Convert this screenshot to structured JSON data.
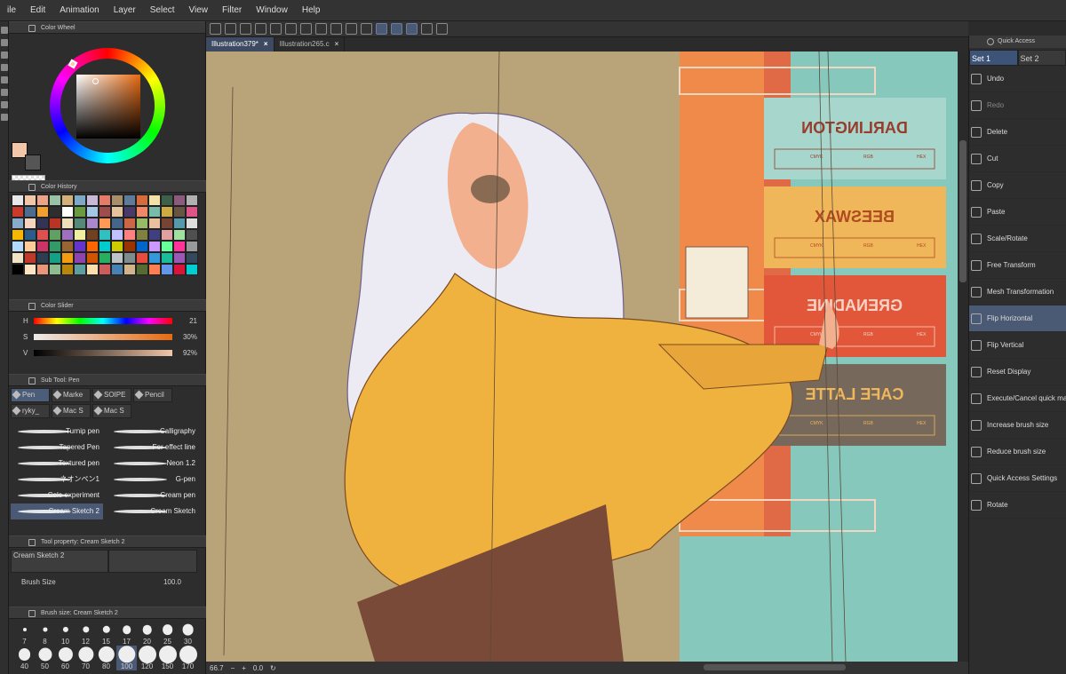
{
  "menu": [
    "ile",
    "Edit",
    "Animation",
    "Layer",
    "Select",
    "View",
    "Filter",
    "Window",
    "Help"
  ],
  "panels": {
    "color_wheel": "Color Wheel",
    "color_history": "Color History",
    "color_slider": "Color Slider",
    "sub_tool": "Sub Tool: Pen",
    "tool_property": "Tool property: Cream Sketch 2",
    "brush_size_panel": "Brush size: Cream Sketch 2"
  },
  "hsv_readout": {
    "h": "21",
    "s": "30",
    "v": "92"
  },
  "sliders": [
    {
      "label": "H",
      "value": "21",
      "gradient": "linear-gradient(to right,#f00,#ff0,#0f0,#0ff,#00f,#f0f,#f00)"
    },
    {
      "label": "S",
      "value": "30%",
      "gradient": "linear-gradient(to right,#ebebeb,#e86a12)"
    },
    {
      "label": "V",
      "value": "92%",
      "gradient": "linear-gradient(to right,#000,#f1c6a9)"
    }
  ],
  "history_colors": [
    "#e8e8e8",
    "#f1c6a9",
    "#e9a48a",
    "#9ac3a5",
    "#d4b07a",
    "#7da9c6",
    "#c7b8d8",
    "#e37d6a",
    "#a88e6b",
    "#5e7c99",
    "#d56b3a",
    "#f4e1a8",
    "#3e5f4a",
    "#8c5a7d",
    "#b0b0b0",
    "#c93a2a",
    "#4c6e8e",
    "#f0a030",
    "#2e2e2e",
    "#ffffff",
    "#6a9a3e",
    "#a4c7e8",
    "#9e4c4c",
    "#e5c39c",
    "#4a3a6a",
    "#ee8866",
    "#77bbaa",
    "#ccaa44",
    "#665544",
    "#dd5588",
    "#88aacc",
    "#f5d5c0",
    "#333355",
    "#bb3322",
    "#eeddbb",
    "#558877",
    "#aa88cc",
    "#ff9955",
    "#446688",
    "#cc6644",
    "#99bb66",
    "#e8c0a0",
    "#774433",
    "#5599aa",
    "#dddddd",
    "#f7b800",
    "#2b5c8a",
    "#e05050",
    "#60a060",
    "#a070c0",
    "#f0f0a0",
    "#704020",
    "#30c0c0",
    "#c0c0ff",
    "#ff8080",
    "#808040",
    "#404080",
    "#e0a0a0",
    "#a0e0a0",
    "#505050",
    "#b3d9ff",
    "#ffcc99",
    "#cc3366",
    "#339966",
    "#996633",
    "#6633cc",
    "#ff6600",
    "#00cccc",
    "#cccc00",
    "#993300",
    "#0066cc",
    "#cc99ff",
    "#66ff99",
    "#ff3399",
    "#999999",
    "#f2e3c6",
    "#c0392b",
    "#2c3e50",
    "#16a085",
    "#f39c12",
    "#8e44ad",
    "#d35400",
    "#27ae60",
    "#bdc3c7",
    "#7f8c8d",
    "#e74c3c",
    "#3498db",
    "#1abc9c",
    "#9b59b6",
    "#34495e",
    "#000000",
    "#ffe4c4",
    "#e9967a",
    "#8fbc8f",
    "#b8860b",
    "#5f9ea0",
    "#ffdead",
    "#cd5c5c",
    "#4682b4",
    "#d2b48c",
    "#556b2f",
    "#ff7f50",
    "#6495ed",
    "#dc143c",
    "#00ced1"
  ],
  "sub_tool_tabs": [
    "Pen",
    "Marke",
    "SOIPE",
    "Pencil",
    "ryky_",
    "Mac S",
    "Mac S"
  ],
  "brushes": [
    {
      "name": "Turnip pen"
    },
    {
      "name": "Calligraphy"
    },
    {
      "name": "Tapered Pen"
    },
    {
      "name": "For effect line"
    },
    {
      "name": "Textured pen"
    },
    {
      "name": "Neon 1.2"
    },
    {
      "name": "ネオンペン1"
    },
    {
      "name": "G-pen"
    },
    {
      "name": "Cole experiment"
    },
    {
      "name": "Cream pen"
    },
    {
      "name": "Cream Sketch 2"
    },
    {
      "name": "Cream Sketch"
    }
  ],
  "tool_property": {
    "preset": "Cream Sketch 2",
    "brush_size_label": "Brush Size",
    "brush_size_value": "100.0"
  },
  "brush_sizes": [
    "7",
    "8",
    "10",
    "12",
    "15",
    "17",
    "20",
    "25",
    "30",
    "40",
    "50",
    "60",
    "70",
    "80",
    "100",
    "120",
    "150",
    "170"
  ],
  "doc_tabs": [
    {
      "name": "Illustration379*",
      "close": "×"
    },
    {
      "name": "Illustration265.c",
      "close": "×"
    }
  ],
  "status": {
    "zoom": "66.7",
    "angle": "0.0"
  },
  "swatch_cards": [
    {
      "name": "DARLINGTON",
      "bg": "#a6d6cc",
      "fg": "#9a3b2c"
    },
    {
      "name": "BEESWAX",
      "bg": "#f0b75a",
      "fg": "#b04a20"
    },
    {
      "name": "GRENADINE",
      "bg": "#e2573a",
      "fg": "#f6d1c4"
    },
    {
      "name": "CAFE LATTE",
      "bg": "#76695c",
      "fg": "#f0b75a"
    }
  ],
  "card_headers": [
    "HEX",
    "RGB",
    "CMYK"
  ],
  "quick_access": {
    "title": "Quick Access",
    "sets": [
      "Set 1",
      "Set 2"
    ],
    "items": [
      {
        "label": "Undo",
        "state": ""
      },
      {
        "label": "Redo",
        "state": "dim"
      },
      {
        "label": "Delete",
        "state": ""
      },
      {
        "label": "Cut",
        "state": ""
      },
      {
        "label": "Copy",
        "state": ""
      },
      {
        "label": "Paste",
        "state": ""
      },
      {
        "label": "Scale/Rotate",
        "state": ""
      },
      {
        "label": "Free Transform",
        "state": ""
      },
      {
        "label": "Mesh Transformation",
        "state": ""
      },
      {
        "label": "Flip Horizontal",
        "state": "sel"
      },
      {
        "label": "Flip Vertical",
        "state": ""
      },
      {
        "label": "Reset Display",
        "state": ""
      },
      {
        "label": "Execute/Cancel quick mask",
        "state": ""
      },
      {
        "label": "Increase brush size",
        "state": ""
      },
      {
        "label": "Reduce brush size",
        "state": ""
      },
      {
        "label": "Quick Access Settings",
        "state": ""
      },
      {
        "label": "Rotate",
        "state": ""
      }
    ]
  }
}
